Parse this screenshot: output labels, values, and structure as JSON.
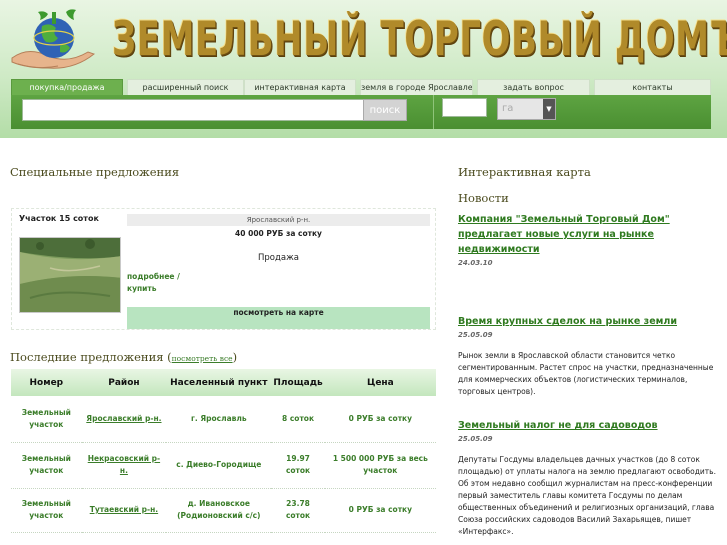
{
  "header": {
    "brand": "ЗЕМЕЛЬНЫЙ ТОРГОВЫЙ ДОМЪ",
    "tabs": [
      {
        "label": "покупка/продажа",
        "active": true
      },
      {
        "label": "расширенный поиск",
        "active": false
      },
      {
        "label": "интерактивная карта",
        "active": false
      },
      {
        "label": "земля в городе Ярославле",
        "active": false
      },
      {
        "label": "задать вопрос",
        "active": false
      },
      {
        "label": "контакты",
        "active": false
      }
    ],
    "search_button": "поиск",
    "area_unit": "га"
  },
  "special": {
    "title": "Специальные предложения",
    "offer": {
      "name": "Участок 15 соток",
      "district": "Ярославский р-н.",
      "price": "40 000 РУБ за сотку",
      "type": "Продажа",
      "more": "подробнее / купить",
      "map_link": "посмотреть на карте"
    }
  },
  "latest": {
    "title": "Последние предложения",
    "see_all": "посмотреть все",
    "columns": [
      "Номер",
      "Район",
      "Населенный пункт",
      "Площадь",
      "Цена"
    ],
    "rows": [
      {
        "number": "Земельный участок",
        "district": "Ярославский р-н.",
        "settlement": "г. Ярославль",
        "area": "8 соток",
        "price": "0 РУБ за сотку"
      },
      {
        "number": "Земельный участок",
        "district": "Некрасовский р-н.",
        "settlement": "с. Диево-Городище",
        "area": "19.97 соток",
        "price": "1 500 000 РУБ за весь участок"
      },
      {
        "number": "Земельный участок",
        "district": "Тутаевский р-н.",
        "settlement": "д. Ивановское (Родионовский с/с)",
        "area": "23.78 соток",
        "price": "0 РУБ за сотку"
      }
    ]
  },
  "right": {
    "map_title": "Интерактивная карта",
    "news_title": "Новости",
    "news": [
      {
        "headline": "Компания \"Земельный Торговый Дом\" предлагает новые услуги на рынке недвижимости",
        "date": "24.03.10",
        "text": ""
      },
      {
        "headline": "Время крупных сделок на рынке земли",
        "date": "25.05.09",
        "text": "Рынок земли в Ярославской области становится четко сегментированным. Растет спрос на участки, предназначенные для коммерческих объектов (логистических терминалов, торговых центров)."
      },
      {
        "headline": "Земельный налог не для садоводов",
        "date": "25.05.09",
        "text": "Депутаты Госдумы владельцев дачных участков (до 8 соток площадью) от уплаты налога на землю предлагают освободить. Об этом недавно сообщил журналистам на пресс-конференции первый заместитель главы комитета Госдумы по делам общественных объединений и религиозных организаций, глава Союза российских садоводов Василий Захарьящев, пишет «Интерфакс»."
      }
    ]
  }
}
